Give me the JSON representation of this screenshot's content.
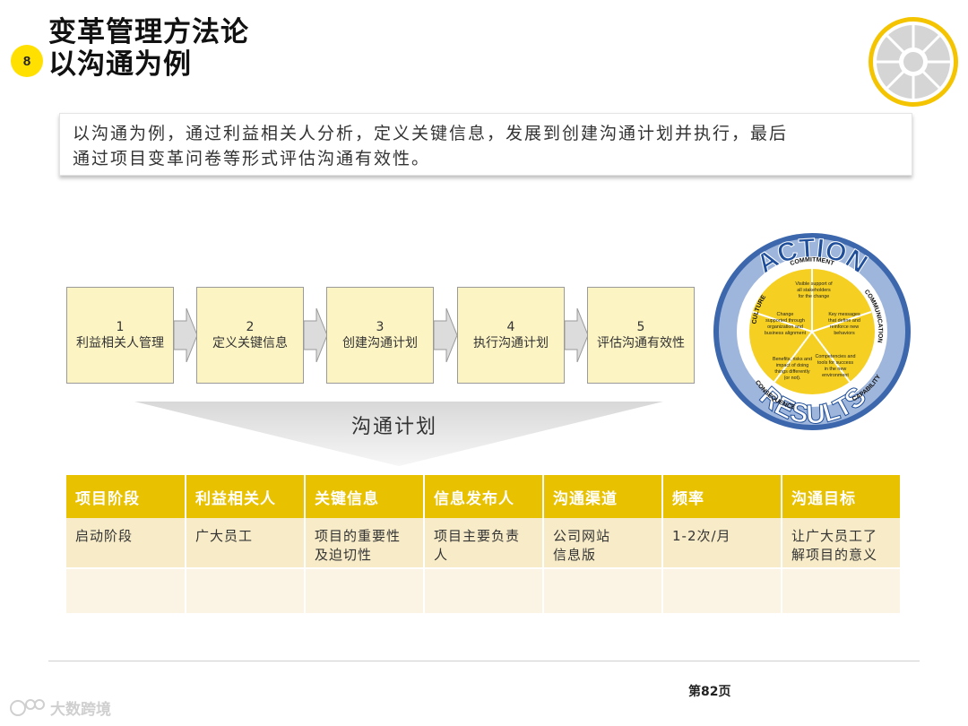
{
  "header": {
    "title_line1": "变革管理方法论",
    "title_line2": "以沟通为例",
    "page_badge": "8"
  },
  "summary": {
    "line1": "以沟通为例，通过利益相关人分析，定义关键信息，发展到创建沟通计划并执行，最后",
    "line2": "通过项目变革问卷等形式评估沟通有效性。"
  },
  "steps": [
    {
      "num": "1",
      "label": "利益相关人管理"
    },
    {
      "num": "2",
      "label": "定义关键信息"
    },
    {
      "num": "3",
      "label": "创建沟通计划"
    },
    {
      "num": "4",
      "label": "执行沟通计划"
    },
    {
      "num": "5",
      "label": "评估沟通有效性"
    }
  ],
  "plan_label": "沟通计划",
  "wheel": {
    "top_word": "ACTION",
    "bottom_word": "RESULTS",
    "ring_labels": {
      "commitment": "COMMITMENT",
      "communication": "COMMUNICATION",
      "capability": "CAPABILITY",
      "consequence": "CONSEQUENCE",
      "culture": "CULTURE"
    },
    "segments": {
      "top": [
        "Visible support of",
        "all stakeholders",
        "for the change"
      ],
      "left": [
        "Change",
        "supported through",
        "organization and",
        "business alignment"
      ],
      "right": [
        "Key messages",
        "that define and",
        "reinforce new",
        "behaviors"
      ],
      "bottom_left": [
        "Benefits, risks and",
        "impact of doing",
        "things differently",
        "(or not)."
      ],
      "bottom_right": [
        "Competencies and",
        "tools for success",
        "in the new",
        "environment"
      ]
    },
    "colors": {
      "blue": "#2f5aa3",
      "yellow": "#f5d022",
      "light_blue": "#9fb6dc"
    }
  },
  "table": {
    "headers": [
      "项目阶段",
      "利益相关人",
      "关键信息",
      "信息发布人",
      "沟通渠道",
      "频率",
      "沟通目标"
    ],
    "rows": [
      [
        [
          "启动阶段"
        ],
        [
          "广大员工"
        ],
        [
          "项目的重要性",
          "及迫切性"
        ],
        [
          "项目主要负责",
          "人"
        ],
        [
          "公司网站",
          "信息版"
        ],
        [
          "1-2次/月"
        ],
        [
          "让广大员工了",
          "解项目的意义"
        ]
      ],
      [
        [
          ""
        ],
        [
          ""
        ],
        [
          ""
        ],
        [
          ""
        ],
        [
          ""
        ],
        [
          ""
        ],
        [
          ""
        ]
      ]
    ]
  },
  "footer": {
    "page_label": "第82页",
    "watermark_text": "大数跨境"
  },
  "colors": {
    "accent_yellow": "#e8c100",
    "badge_yellow": "#ffe000",
    "step_fill": "#fdf4c4"
  }
}
